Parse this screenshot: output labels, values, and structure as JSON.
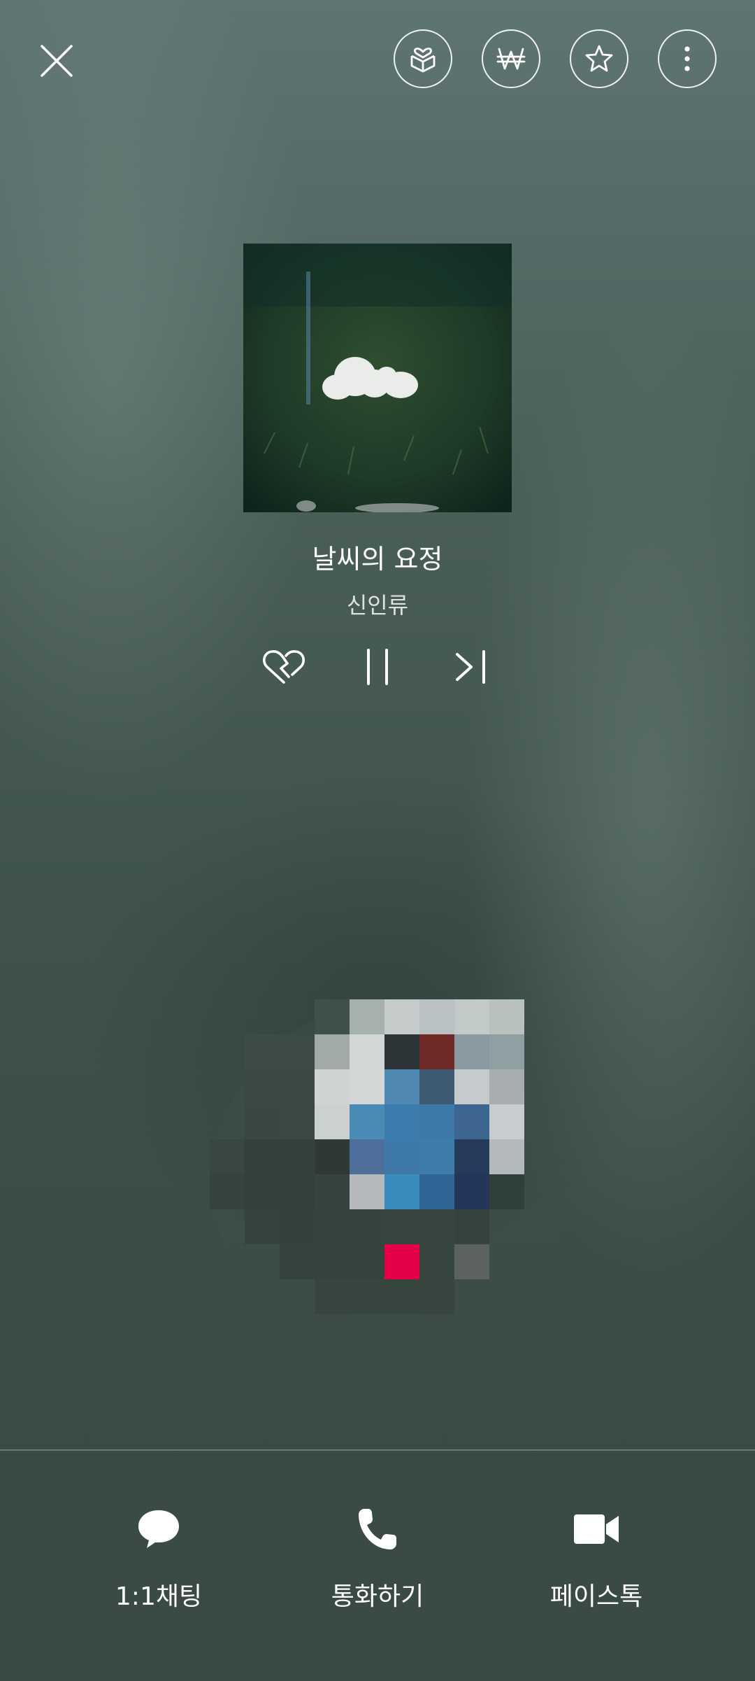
{
  "header": {
    "close_icon": "close-icon",
    "actions": [
      {
        "name": "gift-box-icon"
      },
      {
        "name": "won-currency-icon"
      },
      {
        "name": "star-icon"
      },
      {
        "name": "more-vertical-icon"
      }
    ]
  },
  "music": {
    "title": "날씨의 요정",
    "artist": "신인류",
    "controls": [
      "heart-broken-icon",
      "pause-icon",
      "skip-next-icon"
    ]
  },
  "bottom_actions": [
    {
      "label": "1:1채팅",
      "icon": "chat-bubble-icon"
    },
    {
      "label": "통화하기",
      "icon": "phone-icon"
    },
    {
      "label": "페이스톡",
      "icon": "video-camera-icon"
    }
  ],
  "colors": {
    "background": "#4a5e59",
    "avatar_accent": "#e6004a"
  }
}
